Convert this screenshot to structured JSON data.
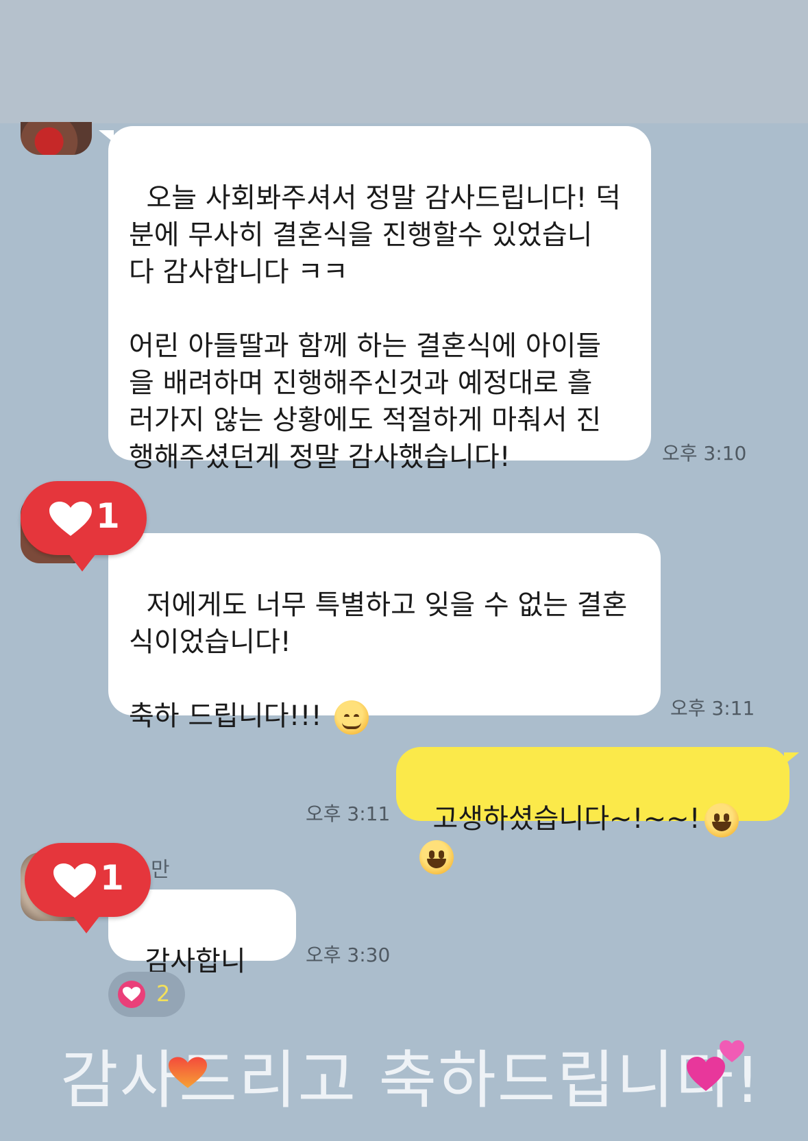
{
  "messages": [
    {
      "from": "other",
      "text": "오늘 사회봐주셔서 정말 감사드립니다! 덕\n분에 무사히 결혼식을 진행할수 있었습니\n다 감사합니다 ㅋㅋ\n\n어린 아들딸과 함께 하는 결혼식에 아이들\n을 배려하며 진행해주신것과 예정대로 흘\n러가지 않는 상황에도 적절하게 마춰서 진\n행해주셨던게 정말 감사했습니다!",
      "time": "오후 3:10"
    },
    {
      "from": "other",
      "text": "저에게도 너무 특별하고 잊을 수 없는 결혼\n식이었습니다!\n\n축하 드립니다!!! ",
      "emoji": "smiling-face-emoji",
      "time": "오후 3:11",
      "like_count": "1"
    },
    {
      "from": "me",
      "text": "고생하셨습니다~!~~!",
      "emoji": "grinning-face-emoji",
      "time": "오후 3:11"
    },
    {
      "from": "other",
      "sender_fragment": "만",
      "text": "감사합니다!",
      "time": "오후 3:30",
      "like_count": "1",
      "reaction_count": "2"
    }
  ],
  "caption": "감사드리고 축하드립니다!",
  "colors": {
    "background": "#abbdcc",
    "my_bubble": "#fbe94a",
    "other_bubble": "#ffffff",
    "like_sticker": "#e5363c",
    "reaction_heart": "#ea3f79"
  }
}
